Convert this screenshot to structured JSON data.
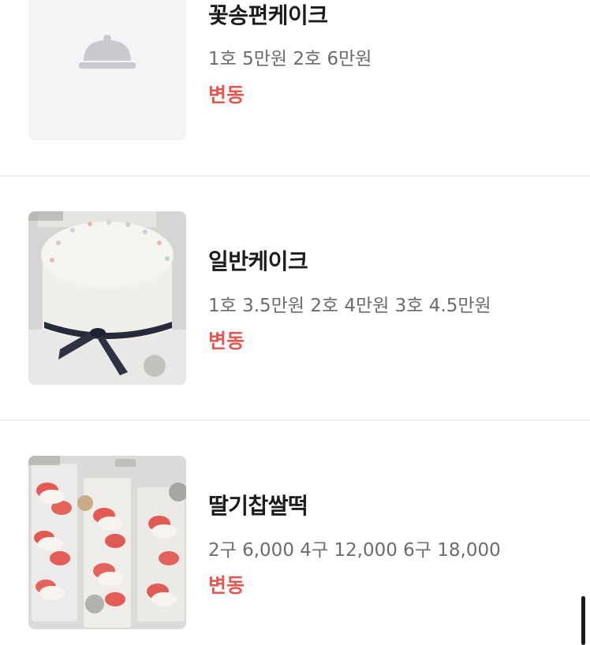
{
  "menu_items": [
    {
      "name": "꽃송편케이크",
      "price": "1호 5만원 2호 6만원",
      "tag": "변동",
      "image": "placeholder-cloche-icon"
    },
    {
      "name": "일반케이크",
      "price": "1호 3.5만원 2호 4만원 3호 4.5만원",
      "tag": "변동",
      "image": "white-cake-photo"
    },
    {
      "name": "딸기찹쌀떡",
      "price": "2구 6,000 4구 12,000 6구 18,000",
      "tag": "변동",
      "image": "strawberry-mochi-photo"
    }
  ],
  "colors": {
    "tag": "#e35a55",
    "name": "#1c1c1e",
    "price": "#6b6b70",
    "divider": "#efeff1",
    "placeholder_bg": "#f3f4f6"
  }
}
